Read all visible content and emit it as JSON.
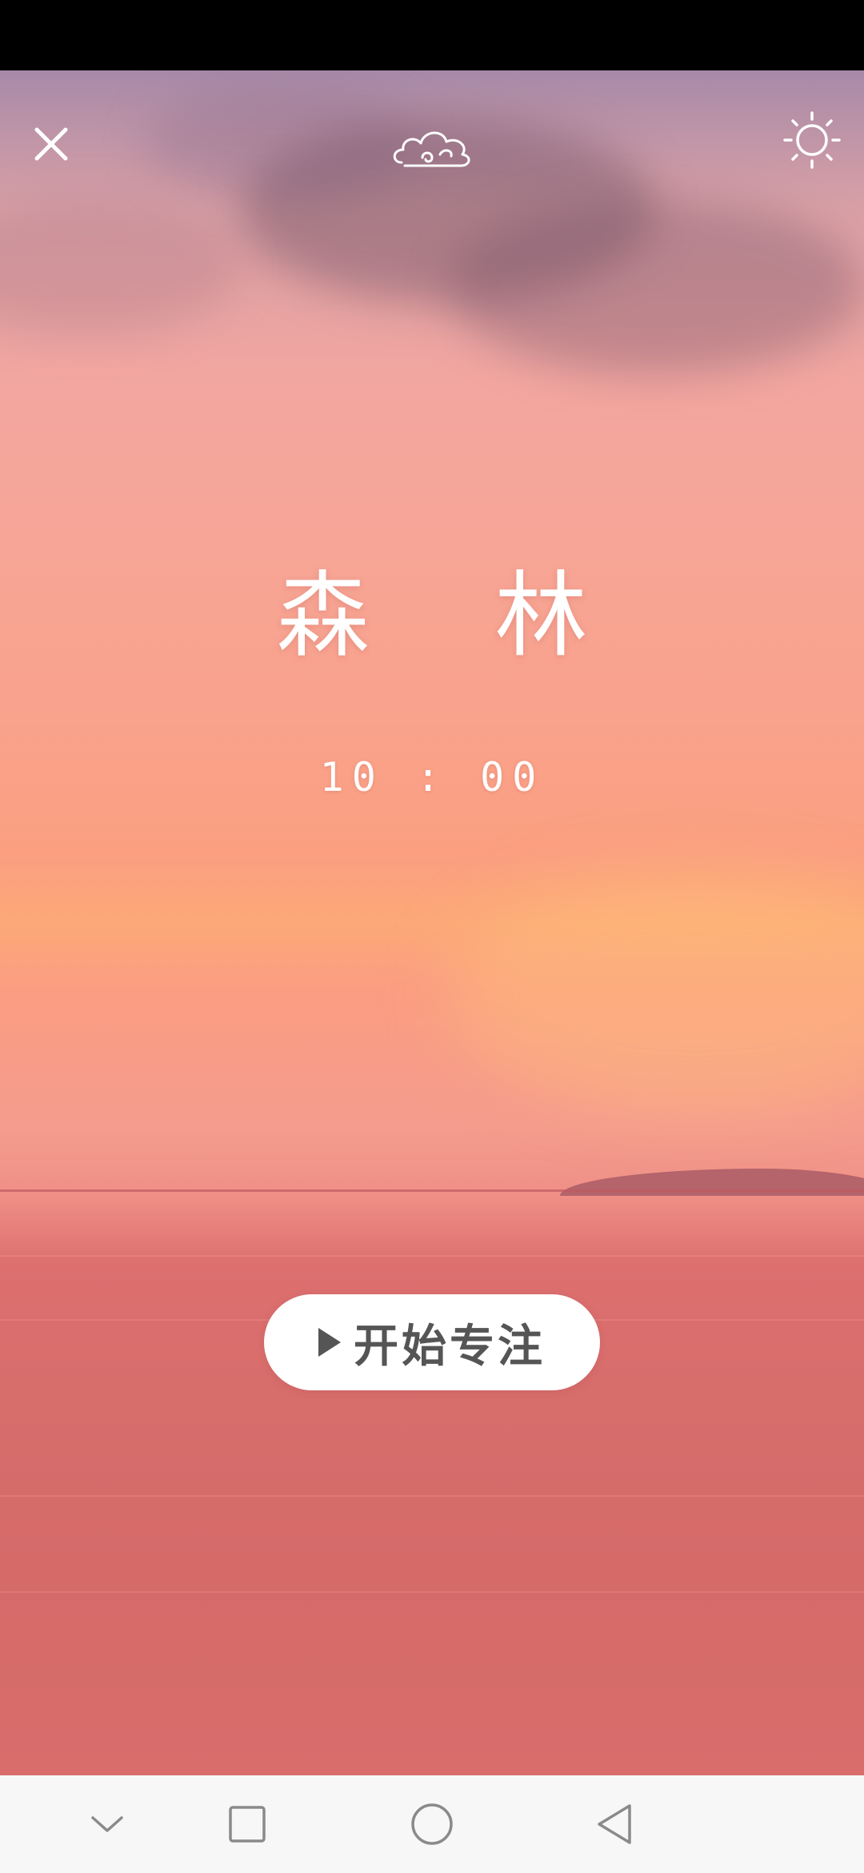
{
  "app": {
    "title": "森 林",
    "timer": "10 : 00",
    "start_label": "开始专注"
  },
  "top_bar": {
    "icons": [
      "close-icon",
      "cloud-icon",
      "brightness-icon"
    ]
  },
  "nav_bar": {
    "icons": [
      "chevron-down-icon",
      "recents-square-icon",
      "home-circle-icon",
      "back-triangle-icon"
    ]
  },
  "colors": {
    "sky_top": "#a78aa8",
    "sky_mid": "#f9a28c",
    "sunset_glow": "#fca878",
    "sea": "#d76e6c",
    "button_bg": "#ffffff",
    "button_text": "#555555",
    "nav_bg": "#f7f7f7"
  }
}
